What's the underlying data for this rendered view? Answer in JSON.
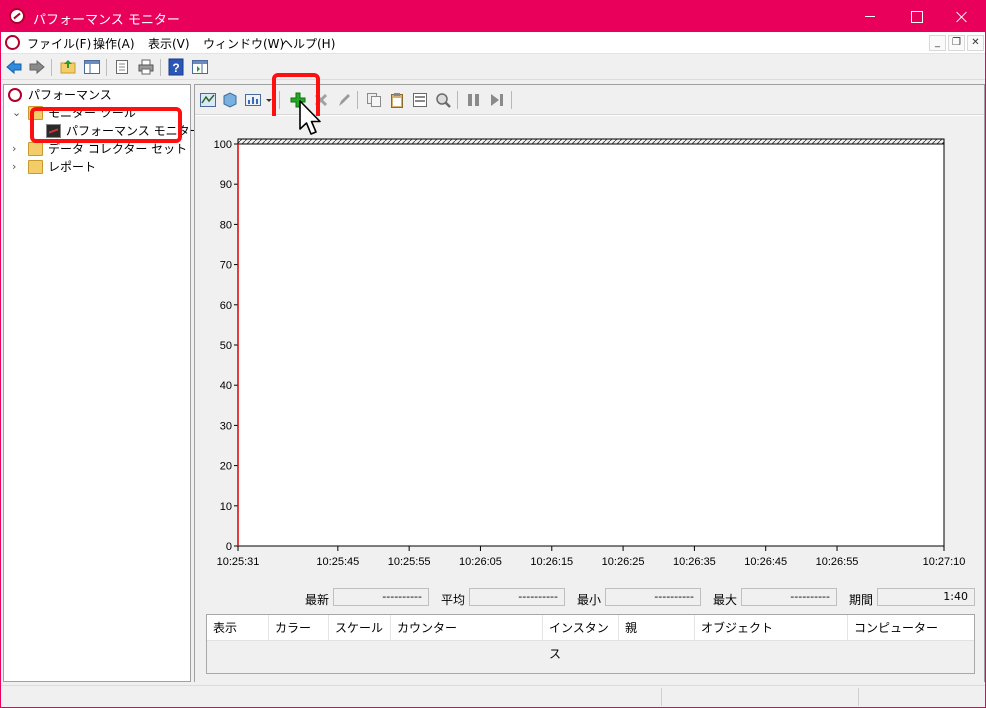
{
  "window": {
    "title": "パフォーマンス モニター"
  },
  "menubar": {
    "items": [
      "ファイル(F)",
      "操作(A)",
      "表示(V)",
      "ウィンドウ(W)",
      "ヘルプ(H)"
    ]
  },
  "toolbar": {
    "icons": [
      "back-icon",
      "forward-icon",
      "up-folder-icon",
      "show-hide-tree-icon",
      "properties-icon",
      "print-icon",
      "help-icon",
      "action-pane-icon"
    ]
  },
  "tree": {
    "root": "パフォーマンス",
    "monitoring_tools": "モニター ツール",
    "performance_monitor": "パフォーマンス モニター",
    "data_collector_sets": "データ コレクター セット",
    "reports": "レポート"
  },
  "graph_toolbar": {
    "icons": [
      "view-current-activity-icon",
      "view-log-data-icon",
      "change-graph-type-icon",
      "dropdown-icon",
      "add-counter-icon",
      "delete-counter-icon",
      "highlight-icon",
      "copy-properties-icon",
      "paste-counter-list-icon",
      "properties-icon",
      "zoom-icon",
      "freeze-display-icon",
      "update-data-icon"
    ]
  },
  "chart_data": {
    "type": "line",
    "ylim": [
      0,
      100
    ],
    "y_ticks": [
      "100",
      "90",
      "80",
      "70",
      "60",
      "50",
      "40",
      "30",
      "20",
      "10",
      "0"
    ],
    "x_ticks": [
      "10:25:31",
      "10:25:45",
      "10:25:55",
      "10:26:05",
      "10:26:15",
      "10:26:25",
      "10:26:35",
      "10:26:45",
      "10:26:55",
      "10:27:10"
    ],
    "series": [],
    "current_time_marker": "10:25:31",
    "marker_color": "#e00000"
  },
  "stats": {
    "last_label": "最新",
    "last_value": "----------",
    "avg_label": "平均",
    "avg_value": "----------",
    "min_label": "最小",
    "min_value": "----------",
    "max_label": "最大",
    "max_value": "----------",
    "duration_label": "期間",
    "duration_value": "1:40"
  },
  "counter_table": {
    "columns": [
      "表示",
      "カラー",
      "スケール",
      "カウンター",
      "インスタンス",
      "親",
      "オブジェクト",
      "コンピューター"
    ],
    "rows": []
  },
  "colors": {
    "titlebar": "#e8005a",
    "highlight": "#ff1010",
    "add_icon": "#22aa22"
  }
}
